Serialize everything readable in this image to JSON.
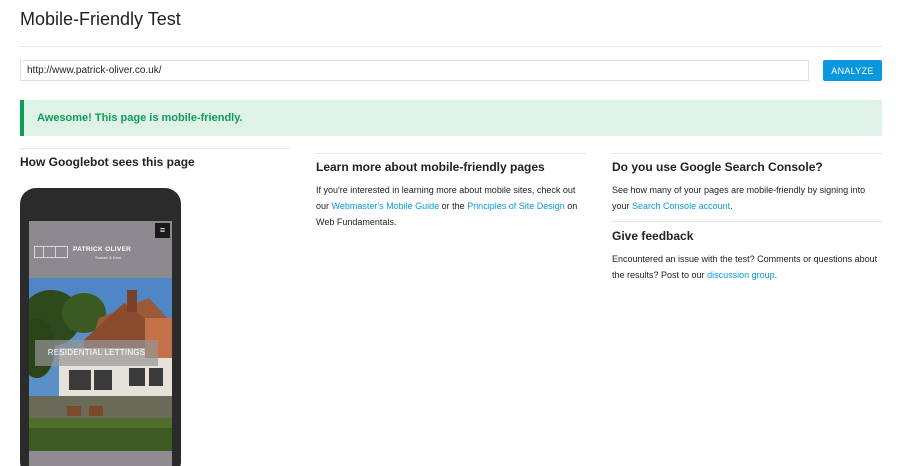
{
  "header": {
    "title": "Mobile-Friendly Test"
  },
  "search": {
    "url_value": "http://www.patrick-oliver.co.uk/",
    "analyze_label": "ANALYZE"
  },
  "result": {
    "message": "Awesome! This page is mobile-friendly."
  },
  "left_column": {
    "heading": "How Googlebot sees this page",
    "preview": {
      "logo_name": "PATRICK OLIVER",
      "logo_tagline": "Sussex & Kent",
      "menu_icon": "menu-icon",
      "hero_label": "RESIDENTIAL LETTINGS"
    }
  },
  "middle_column": {
    "heading": "Learn more about mobile-friendly pages",
    "text_1": "If you're interested in learning more about mobile sites, check out our",
    "link_1": "Webmaster's Mobile Guide",
    "text_2": "or the",
    "link_2": "Principles of Site Design",
    "text_3": "on Web Fundamentals."
  },
  "right_column": {
    "console_heading": "Do you use Google Search Console?",
    "console_text": "See how many of your pages are mobile-friendly by signing into your",
    "console_link": "Search Console account",
    "console_end": ".",
    "feedback_heading": "Give feedback",
    "feedback_text": "Encountered an issue with the test? Comments or questions about the results? Post to our",
    "feedback_link": "discussion group",
    "feedback_end": "."
  },
  "colors": {
    "accent": "#0a97dd",
    "success": "#0f9d58",
    "success_bg": "#dff2e8"
  }
}
